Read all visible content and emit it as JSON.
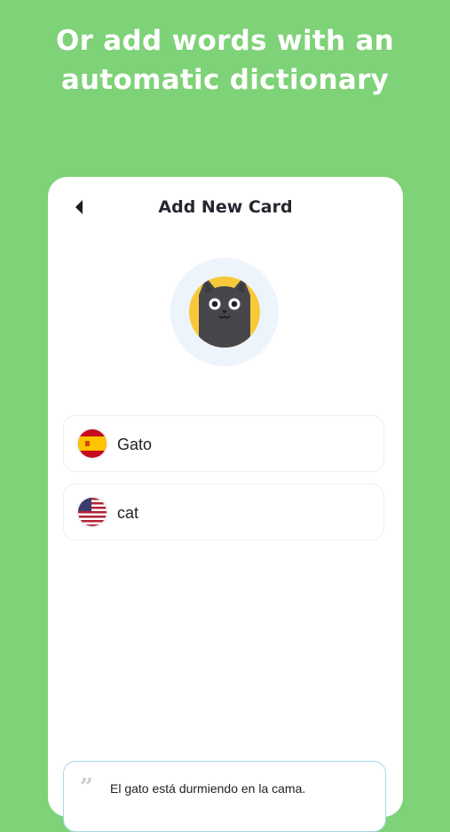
{
  "headline": {
    "line1": "Or add words with an",
    "line2": "automatic dictionary"
  },
  "card": {
    "title": "Add New Card",
    "back_icon": "back-arrow-icon",
    "avatar_icon": "black-cat-icon"
  },
  "fields": [
    {
      "flag_icon": "spain-flag-icon",
      "value": "Gato"
    },
    {
      "flag_icon": "usa-flag-icon",
      "value": "cat"
    }
  ],
  "example": {
    "quote_icon": "quote-icon",
    "sentence": "El gato está durmiendo en la cama."
  },
  "colors": {
    "background": "#7ed277",
    "card": "#ffffff",
    "avatar_ring": "#eef4fb",
    "avatar_circle": "#f7c93a",
    "example_border": "#a9d6ea"
  }
}
